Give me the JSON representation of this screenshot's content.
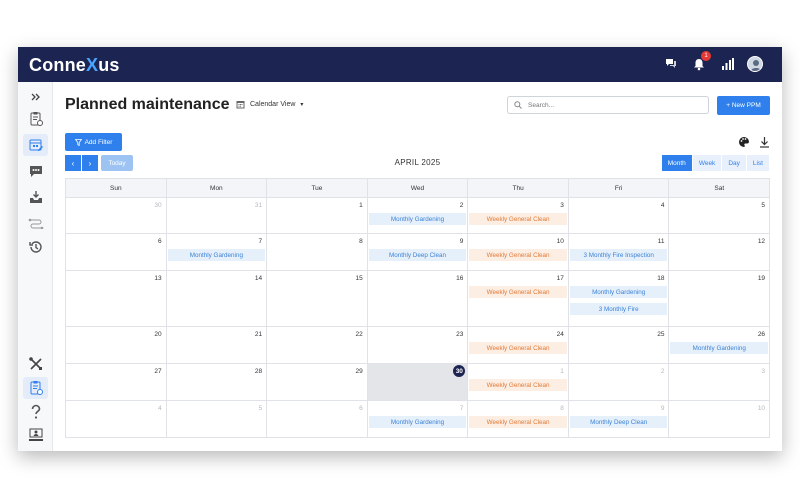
{
  "app": {
    "logo_prefix": "Conne",
    "logo_x": "X",
    "logo_suffix": "us",
    "notification_count": "1"
  },
  "header": {
    "title": "Planned maintenance",
    "view_label": "Calendar View",
    "search_placeholder": "Search...",
    "new_button": "+ New PPM"
  },
  "toolbar": {
    "add_filter": "Add Filter",
    "prev": "‹",
    "next": "›",
    "today": "Today",
    "month_title": "APRIL 2025",
    "views": [
      "Month",
      "Week",
      "Day",
      "List"
    ],
    "active_view": "Month"
  },
  "calendar": {
    "weekdays": [
      "Sun",
      "Mon",
      "Tue",
      "Wed",
      "Thu",
      "Fri",
      "Sat"
    ],
    "weeks": [
      {
        "days": [
          {
            "num": "30",
            "muted": true,
            "events": []
          },
          {
            "num": "31",
            "muted": true,
            "events": []
          },
          {
            "num": "1",
            "events": []
          },
          {
            "num": "2",
            "events": [
              {
                "title": "Monthly Gardening",
                "color": "blue"
              }
            ]
          },
          {
            "num": "3",
            "events": [
              {
                "title": "Weekly General Clean",
                "color": "orange"
              }
            ]
          },
          {
            "num": "4",
            "events": []
          },
          {
            "num": "5",
            "events": []
          }
        ]
      },
      {
        "days": [
          {
            "num": "6",
            "events": []
          },
          {
            "num": "7",
            "events": [
              {
                "title": "Monthly Gardening",
                "color": "blue"
              }
            ]
          },
          {
            "num": "8",
            "events": []
          },
          {
            "num": "9",
            "events": [
              {
                "title": "Monthly Deep Clean",
                "color": "blue"
              }
            ]
          },
          {
            "num": "10",
            "events": [
              {
                "title": "Weekly General Clean",
                "color": "orange"
              }
            ]
          },
          {
            "num": "11",
            "events": [
              {
                "title": "3 Monthly Fire Inspection",
                "color": "blue"
              }
            ]
          },
          {
            "num": "12",
            "events": []
          }
        ]
      },
      {
        "days": [
          {
            "num": "13",
            "events": []
          },
          {
            "num": "14",
            "events": []
          },
          {
            "num": "15",
            "events": []
          },
          {
            "num": "16",
            "events": []
          },
          {
            "num": "17",
            "events": [
              {
                "title": "Weekly General Clean",
                "color": "orange"
              }
            ]
          },
          {
            "num": "18",
            "events": [
              {
                "title": "Monthly Gardening",
                "color": "blue"
              },
              {
                "title": "3 Monthly Fire",
                "color": "blue"
              }
            ]
          },
          {
            "num": "19",
            "events": []
          }
        ]
      },
      {
        "days": [
          {
            "num": "20",
            "events": []
          },
          {
            "num": "21",
            "events": []
          },
          {
            "num": "22",
            "events": []
          },
          {
            "num": "23",
            "events": []
          },
          {
            "num": "24",
            "events": [
              {
                "title": "Weekly General Clean",
                "color": "orange"
              }
            ]
          },
          {
            "num": "25",
            "events": []
          },
          {
            "num": "26",
            "events": [
              {
                "title": "Monthly Gardening",
                "color": "blue"
              }
            ]
          }
        ]
      },
      {
        "days": [
          {
            "num": "27",
            "events": []
          },
          {
            "num": "28",
            "events": []
          },
          {
            "num": "29",
            "events": []
          },
          {
            "num": "30",
            "today": true,
            "events": []
          },
          {
            "num": "1",
            "muted": true,
            "events": [
              {
                "title": "Weekly General Clean",
                "color": "orange"
              }
            ]
          },
          {
            "num": "2",
            "muted": true,
            "events": []
          },
          {
            "num": "3",
            "muted": true,
            "events": []
          }
        ]
      },
      {
        "days": [
          {
            "num": "4",
            "muted": true,
            "events": []
          },
          {
            "num": "5",
            "muted": true,
            "events": []
          },
          {
            "num": "6",
            "muted": true,
            "events": []
          },
          {
            "num": "7",
            "muted": true,
            "events": [
              {
                "title": "Monthly Gardening",
                "color": "blue"
              }
            ]
          },
          {
            "num": "8",
            "muted": true,
            "events": [
              {
                "title": "Weekly General Clean",
                "color": "orange"
              }
            ]
          },
          {
            "num": "9",
            "muted": true,
            "events": [
              {
                "title": "Monthly Deep Clean",
                "color": "blue"
              }
            ]
          },
          {
            "num": "10",
            "muted": true,
            "events": []
          }
        ]
      }
    ]
  },
  "sidebar": {
    "items": [
      {
        "icon": "collapse-icon"
      },
      {
        "icon": "clipboard-gear-icon"
      },
      {
        "icon": "calendar-edit-icon",
        "active": true
      },
      {
        "icon": "chat-icon"
      },
      {
        "icon": "inbox-download-icon"
      },
      {
        "icon": "route-icon"
      },
      {
        "icon": "history-icon"
      },
      {
        "icon": "tools-icon"
      },
      {
        "icon": "clipboard-settings-icon",
        "active": true
      },
      {
        "icon": "help-icon"
      },
      {
        "icon": "monitor-user-icon"
      }
    ]
  },
  "colors": {
    "navy": "#1c2552",
    "primary": "#2f80ed",
    "event_blue": "#3b82d6",
    "event_orange": "#e07a38"
  }
}
